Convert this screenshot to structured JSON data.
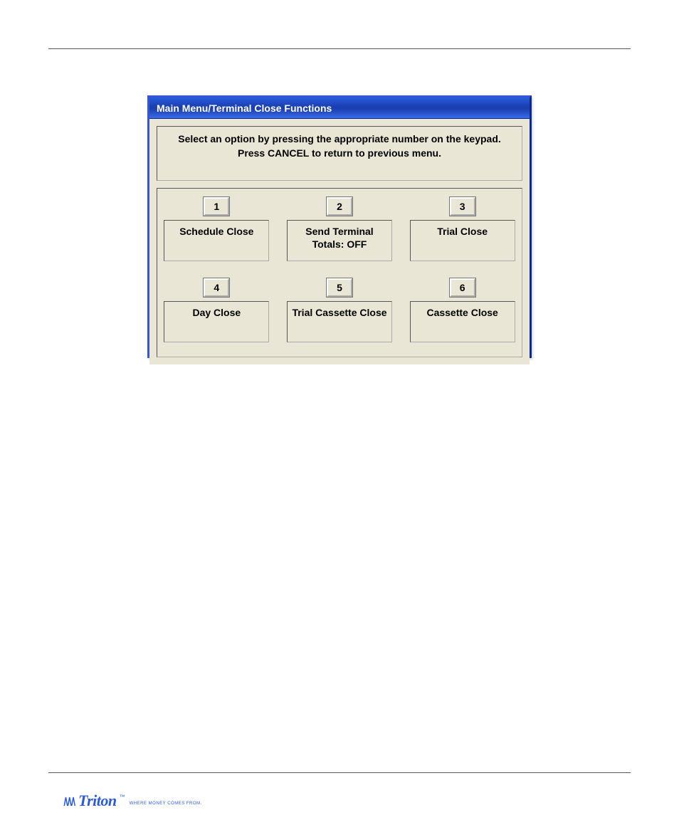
{
  "window": {
    "title": "Main Menu/Terminal Close Functions",
    "prompt_line1": "Select an option by pressing the appropriate number on the keypad.",
    "prompt_line2": "Press CANCEL to return to previous menu.",
    "options": [
      {
        "num": "1",
        "label": "Schedule Close"
      },
      {
        "num": "2",
        "label": "Send Terminal Totals: OFF"
      },
      {
        "num": "3",
        "label": "Trial Close"
      },
      {
        "num": "4",
        "label": "Day Close"
      },
      {
        "num": "5",
        "label": "Trial Cassette Close"
      },
      {
        "num": "6",
        "label": "Cassette Close"
      }
    ]
  },
  "footer": {
    "brand": "Triton",
    "tagline": "WHERE MONEY COMES FROM.",
    "tm": "™"
  }
}
